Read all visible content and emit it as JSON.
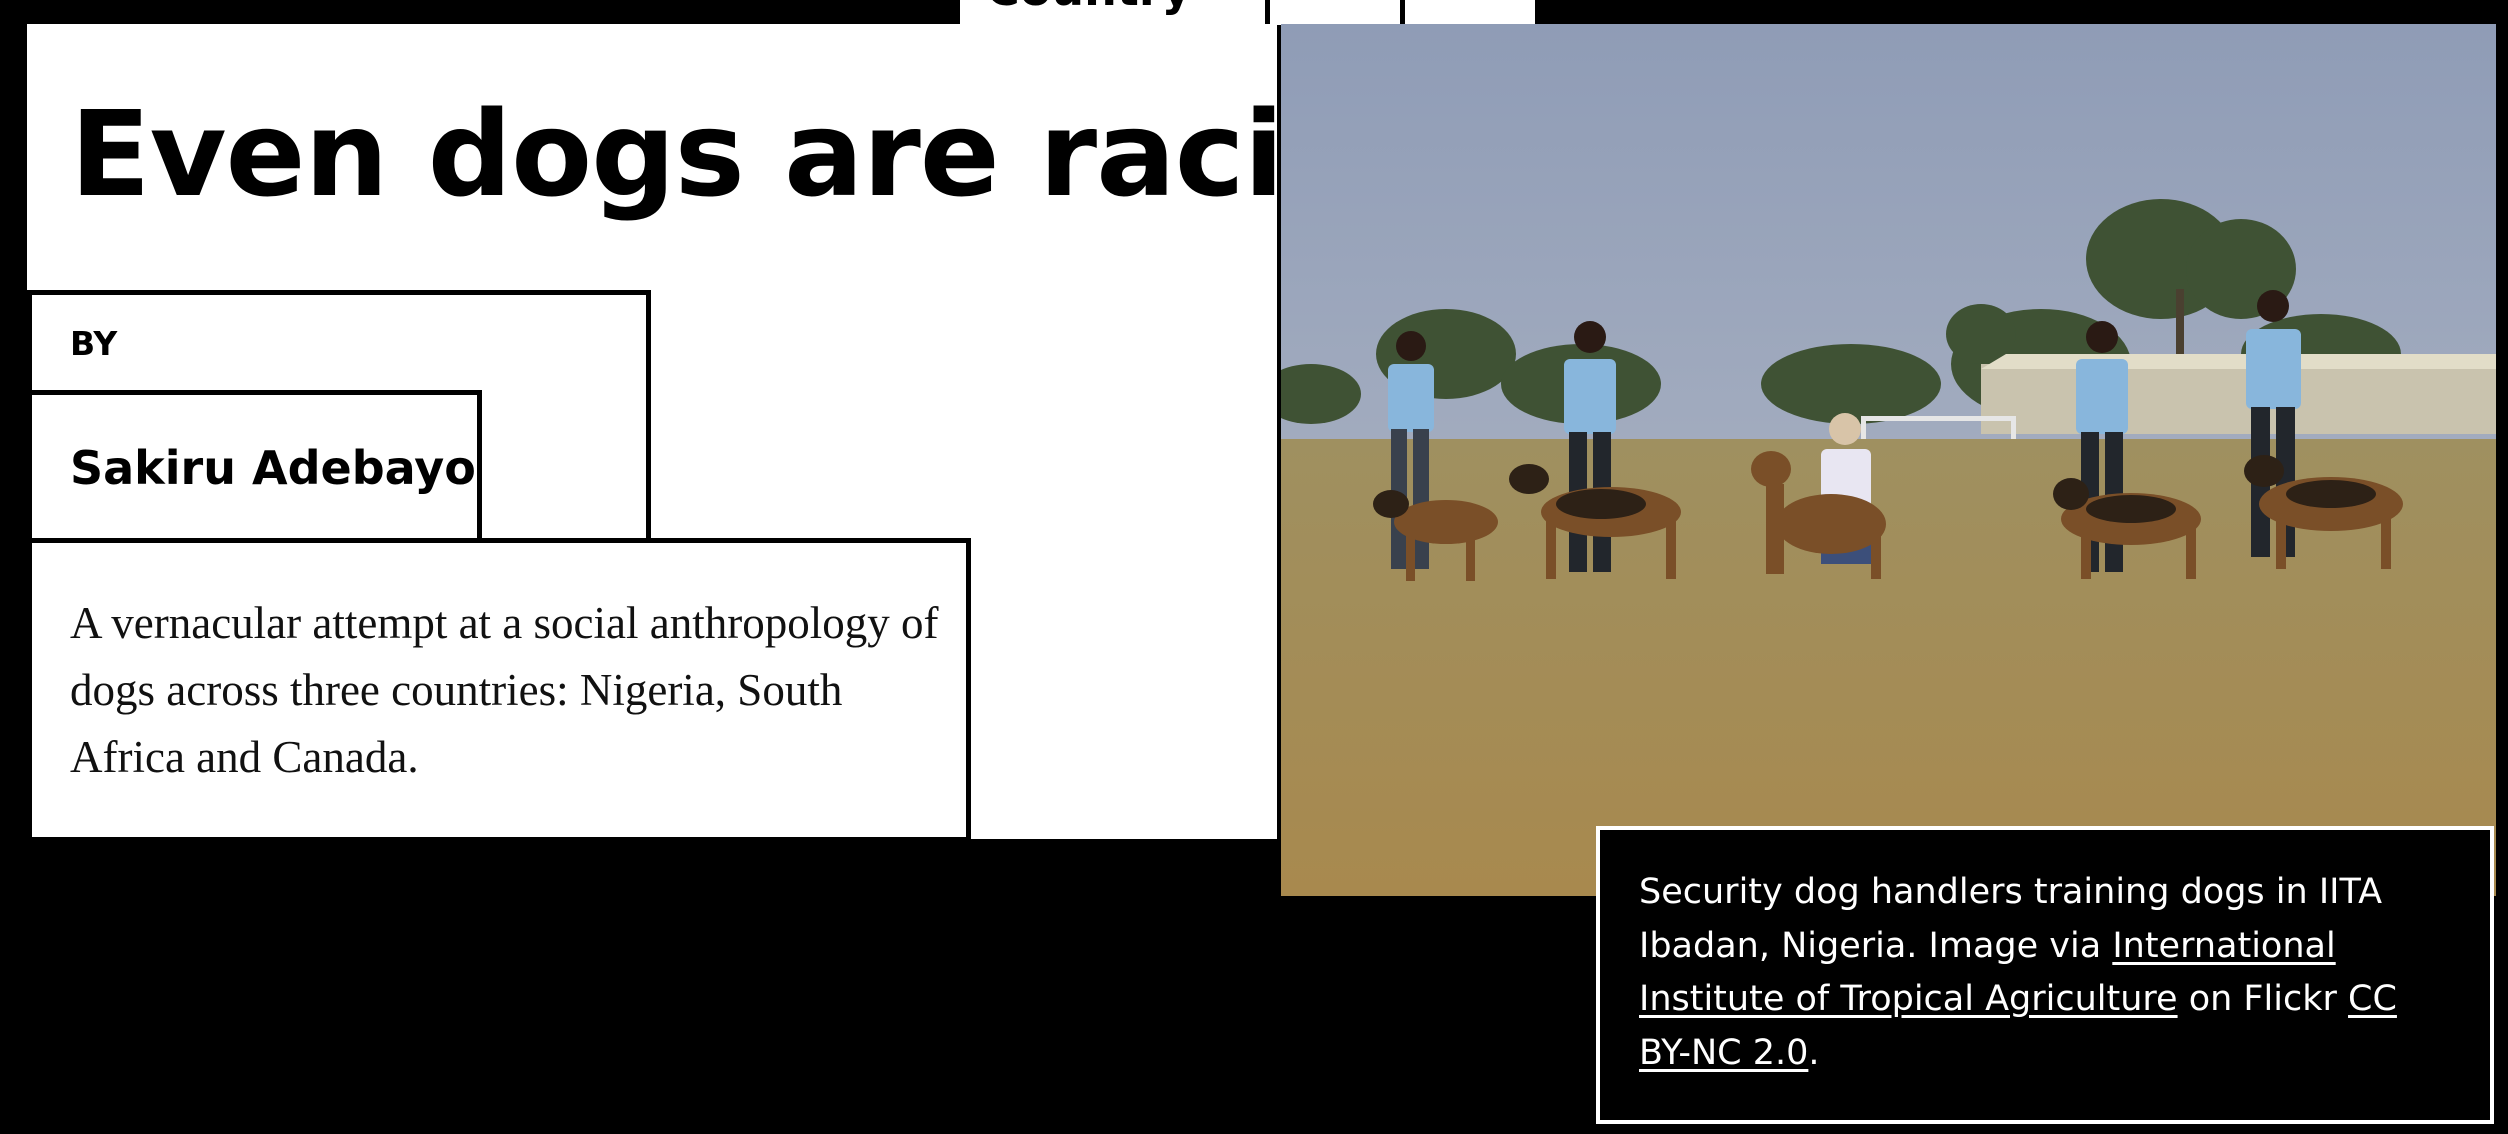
{
  "top_tabs": [
    {
      "label": "Country"
    },
    {
      "label": ""
    },
    {
      "label": ""
    }
  ],
  "article": {
    "title": "Even dogs are racist",
    "by_label": "BY",
    "author": "Sakiru Adebayo",
    "description": "A vernacular attempt at a social anthropology of dogs across three countries: Nigeria, South Africa and Canada."
  },
  "photo": {
    "subject": "dog handlers in blue shirts with German shepherds on a grass field"
  },
  "caption": {
    "text_1": "Security dog handlers training dogs in IITA Ibadan, Nigeria. Image via ",
    "link_1": "International Institute of Tropical Agriculture",
    "text_2": " on Flickr ",
    "link_2": "CC BY-NC 2.0",
    "text_3": "."
  },
  "colors": {
    "background": "#000000",
    "panel": "#ffffff",
    "sky": "#a3aec2",
    "grass": "#a48d55",
    "shirt": "#88b6dc"
  }
}
